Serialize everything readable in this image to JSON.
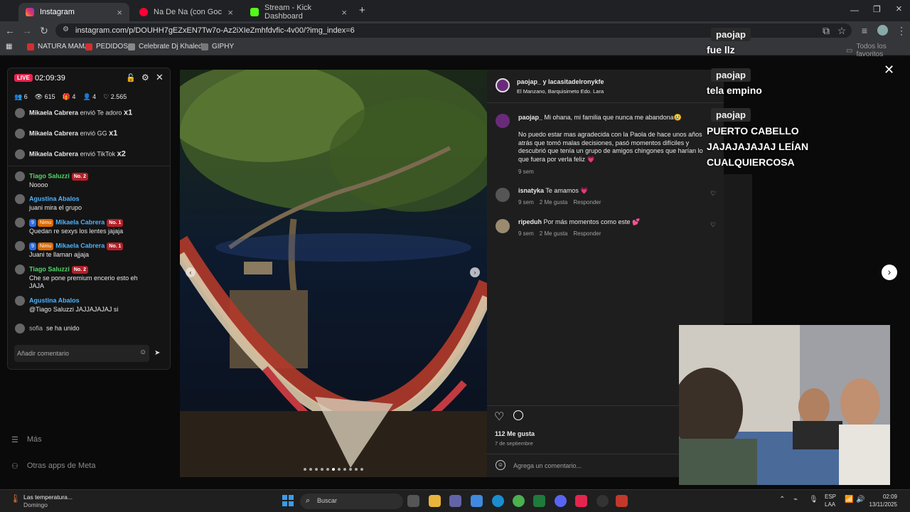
{
  "browser": {
    "tabs": [
      {
        "label": "Instagram",
        "active": true,
        "color": "#e1306c"
      },
      {
        "label": "Na De Na (con Gocho \"El L",
        "active": false,
        "color": "#ff0033"
      },
      {
        "label": "Stream - Kick Dashboard",
        "active": false,
        "color": "#53fc18"
      }
    ],
    "new_tab": "+",
    "url": "instagram.com/p/DOUHH7gEZxEN7Tw7o-Az2iXIeZmhfdvfic-4v00/?img_index=6",
    "bookmarks": [
      "NATURA MAMA",
      "PEDIDOS",
      "Celebrate Dj Khaled...",
      "GIPHY"
    ],
    "all_bookmarks": "Todos los favoritos"
  },
  "kick": {
    "live": "LIVE",
    "timer": "02:09:39",
    "stats": [
      "6",
      "615",
      "4",
      "4",
      "2.565"
    ],
    "gifts": [
      {
        "user": "Mikaela Cabrera",
        "text": "envió Te adoro",
        "count": "x1"
      },
      {
        "user": "Mikaela Cabrera",
        "text": "envió GG",
        "count": "x1"
      },
      {
        "user": "Mikaela Cabrera",
        "text": "envió TikTok",
        "count": "x2"
      }
    ],
    "chat": [
      {
        "user": "Tiago Saluzzi",
        "badge": "No. 2",
        "text": "Noooo"
      },
      {
        "user": "Agustina Abalos",
        "badge": "",
        "text": "juani mira el grupo"
      },
      {
        "user": "Mikaela Cabrera",
        "badge": "No. 1",
        "pre": "9",
        "tag": "Nimu",
        "text": "Quedan re sexys los lentes jajaja"
      },
      {
        "user": "Mikaela Cabrera",
        "badge": "No. 1",
        "pre": "9",
        "tag": "Nimu",
        "text": "Juani te llaman ajjaja"
      },
      {
        "user": "Tiago Saluzzi",
        "badge": "No. 2",
        "text": "Che se pone premium encerio esto eh JAJA"
      },
      {
        "user": "Agustina Abalos",
        "badge": "",
        "text": "@Tiago Saluzzi JAJJAJAJAJ si"
      }
    ],
    "join": {
      "user": "sofia",
      "text": "se ha unido"
    },
    "input_placeholder": "Añadir comentario"
  },
  "ig_sidebar": {
    "more": "Más",
    "meta_apps": "Otras apps de Meta"
  },
  "post": {
    "author": "paojap_ y lacasitadelronykfe",
    "location": "El Manzano, Barquisimeto Edo. Lara",
    "caption_user": "paojap_",
    "caption_first": "Mi ohana, mi familia que nunca me abandona😢",
    "caption_body": "No puedo estar mas agradecida con la Paola de hace unos años atrás que tomó malas decisiones, pasó momentos difíciles y descubrió que tenía un grupo de amigos chingones que harían lo que fuera por verla feliz 💗",
    "caption_time": "9 sem",
    "comments": [
      {
        "user": "isnatyka",
        "text": "Te amamos 💗",
        "time": "9 sem",
        "likes": "2 Me gusta",
        "reply": "Responder"
      },
      {
        "user": "ripeduh",
        "text": "Por más momentos como este 💕",
        "time": "9 sem",
        "likes": "2 Me gusta",
        "reply": "Responder"
      }
    ],
    "likes": "112 Me gusta",
    "date": "7 de septiembre",
    "add_comment": "Agrega un comentario..."
  },
  "overlay": [
    {
      "name": "paojap",
      "message": "fue llz"
    },
    {
      "name": "paojap",
      "message": "tela empino"
    },
    {
      "name": "paojap",
      "message_lines": [
        "PUERTO CABELLO",
        "JAJAJAJAJAJ LEÍAN",
        "CUALQUIERCOSA"
      ]
    }
  ],
  "taskbar": {
    "weather": "Las temperatura...",
    "weather_sub": "Domingo",
    "search": "Buscar",
    "lang": "ESP",
    "lang_sub": "LAA",
    "time": "02:09",
    "date": "13/11/2025"
  }
}
